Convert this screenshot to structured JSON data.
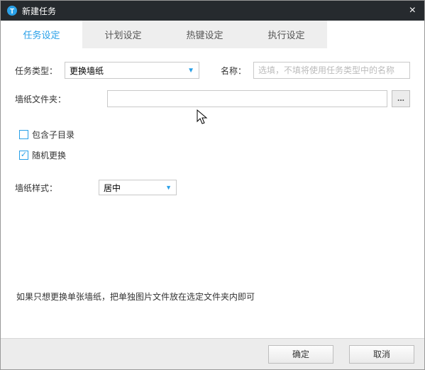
{
  "window": {
    "title": "新建任务"
  },
  "tabs": {
    "items": [
      "任务设定",
      "计划设定",
      "热键设定",
      "执行设定"
    ],
    "active": 0
  },
  "form": {
    "task_type_label": "任务类型：",
    "task_type_value": "更换墙纸",
    "name_label": "名称：",
    "name_placeholder": "选填，不填将使用任务类型中的名称",
    "name_value": "",
    "folder_label": "墙纸文件夹：",
    "folder_value": "",
    "browse_label": "...",
    "include_sub_label": "包含子目录",
    "include_sub_checked": false,
    "random_label": "随机更换",
    "random_checked": true,
    "style_label": "墙纸样式：",
    "style_value": "居中"
  },
  "hint": "如果只想更换单张墙纸，把单独图片文件放在选定文件夹内即可",
  "footer": {
    "ok": "确定",
    "cancel": "取消"
  },
  "icons": {
    "logo": "app-logo-icon",
    "close": "close-icon",
    "caret": "caret-down-icon",
    "cursor": "cursor-icon"
  }
}
